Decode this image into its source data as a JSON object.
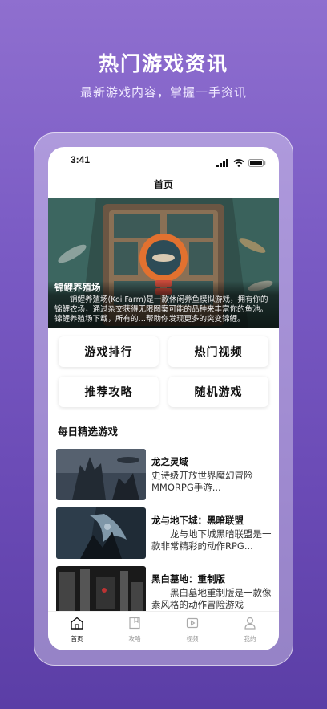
{
  "hero": {
    "title": "热门游戏资讯",
    "subtitle": "最新游戏内容，掌握一手资讯"
  },
  "status_bar": {
    "time": "3:41"
  },
  "nav": {
    "title": "首页"
  },
  "banner": {
    "title": "锦鲤养殖场",
    "description": "锦鲤养殖场(Koi Farm)是一款休闲养鱼模拟游戏，拥有你的锦鲤农场，通过杂交获得无限图案可能的品种来丰富你的鱼池。锦鲤养殖场下载，所有的…帮助你发现更多的突变锦鲤。"
  },
  "grid": [
    {
      "label": "游戏排行"
    },
    {
      "label": "热门视频"
    },
    {
      "label": "推荐攻略"
    },
    {
      "label": "随机游戏"
    }
  ],
  "section": {
    "title": "每日精选游戏"
  },
  "games": [
    {
      "name": "龙之灵域",
      "description": "史诗级开放世界魔幻冒险MMORPG手游..."
    },
    {
      "name": "龙与地下城：黑暗联盟",
      "description": "龙与地下城黑暗联盟是一款非常精彩的动作RPG..."
    },
    {
      "name": "黑白墓地：重制版",
      "description": "黑白墓地重制版是一款像素风格的动作冒险游戏"
    }
  ],
  "tabs": [
    {
      "label": "首页",
      "icon": "home-icon",
      "active": true
    },
    {
      "label": "攻略",
      "icon": "book-icon",
      "active": false
    },
    {
      "label": "视频",
      "icon": "video-icon",
      "active": false
    },
    {
      "label": "我的",
      "icon": "user-icon",
      "active": false
    }
  ],
  "colors": {
    "accent": "#7a5bc4",
    "text": "#111111",
    "muted": "#999999"
  }
}
